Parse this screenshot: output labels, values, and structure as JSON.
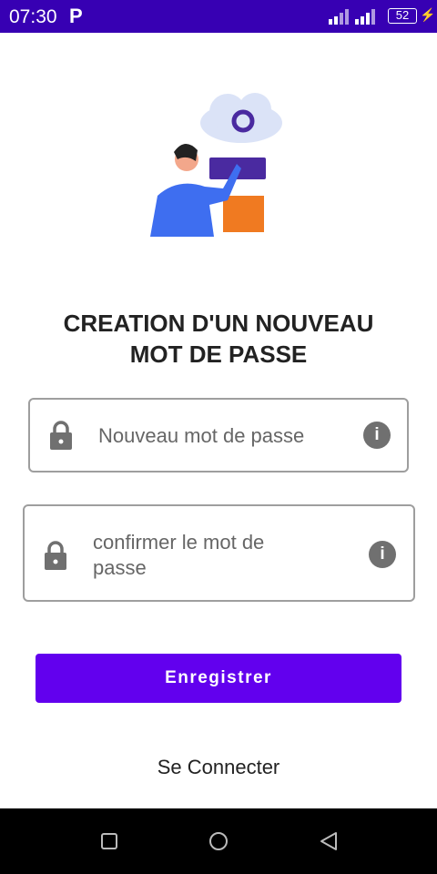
{
  "status_bar": {
    "time": "07:30",
    "app_icon": "P",
    "battery": "52",
    "background": "#3700b3"
  },
  "illustration": {
    "icon": "cloud-settings-illustration"
  },
  "title_line1": "CREATION D'UN NOUVEAU",
  "title_line2": "MOT DE PASSE",
  "fields": [
    {
      "placeholder": "Nouveau mot de passe",
      "icon": "lock-icon",
      "end_icon": "info-icon"
    },
    {
      "placeholder": "confirmer le mot de passe",
      "icon": "lock-icon",
      "end_icon": "info-icon"
    }
  ],
  "info_glyph": "i",
  "submit_label": "Enregistrer",
  "login_link": "Se Connecter",
  "accent": "#6200ee"
}
